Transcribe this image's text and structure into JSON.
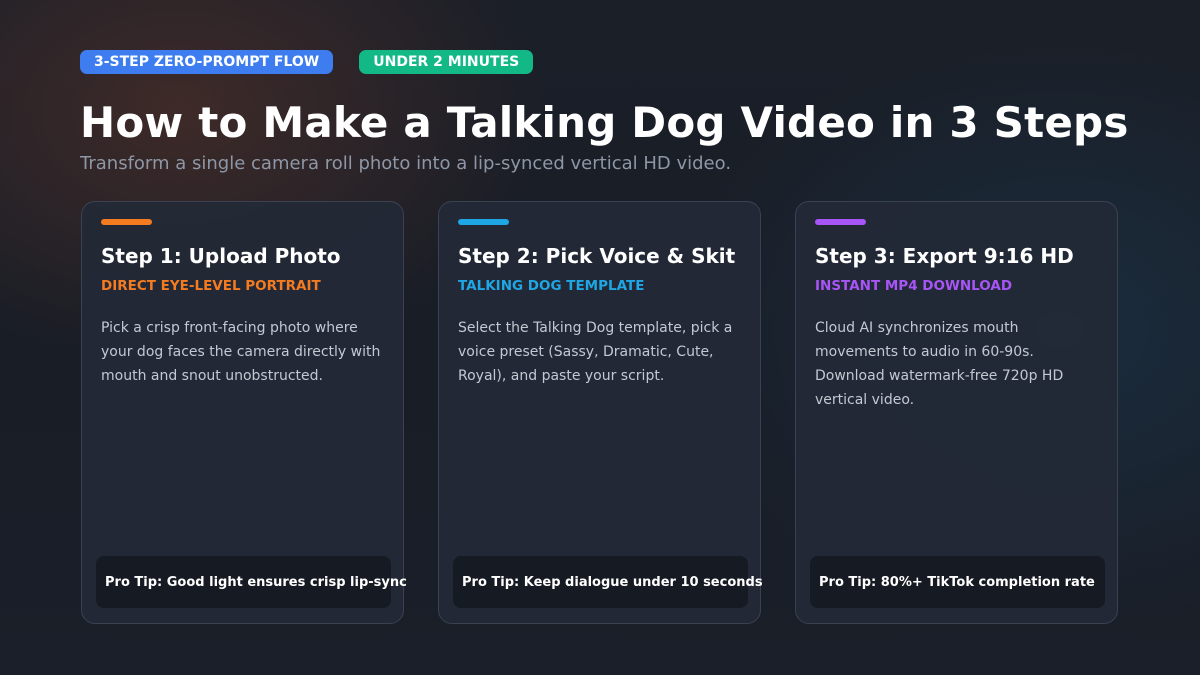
{
  "colors": {
    "badge_blue": "#3d7df0",
    "badge_green": "#12b886",
    "step1_accent": "#f47b20",
    "step2_accent": "#1ea7e4",
    "step3_accent": "#a855f7"
  },
  "badges": [
    {
      "label": "3-STEP ZERO-PROMPT FLOW"
    },
    {
      "label": "UNDER 2 MINUTES"
    }
  ],
  "header": {
    "title": "How to Make a Talking Dog Video in 3 Steps",
    "subtitle": "Transform a single camera roll photo into a lip-synced vertical HD video."
  },
  "steps": [
    {
      "title": "Step 1: Upload Photo",
      "tag": "DIRECT EYE-LEVEL PORTRAIT",
      "description": "Pick a crisp front-facing photo where your dog faces the camera directly with mouth and snout unobstructed.",
      "tip": "Pro Tip: Good light ensures crisp lip-sync"
    },
    {
      "title": "Step 2: Pick Voice & Skit",
      "tag": "TALKING DOG TEMPLATE",
      "description": "Select the Talking Dog template, pick a voice preset (Sassy, Dramatic, Cute, Royal), and paste your script.",
      "tip": "Pro Tip: Keep dialogue under 10 seconds"
    },
    {
      "title": "Step 3: Export 9:16 HD",
      "tag": "INSTANT MP4 DOWNLOAD",
      "description": "Cloud AI synchronizes mouth movements to audio in 60-90s. Download watermark-free 720p HD vertical video.",
      "tip": "Pro Tip: 80%+ TikTok completion rate"
    }
  ]
}
